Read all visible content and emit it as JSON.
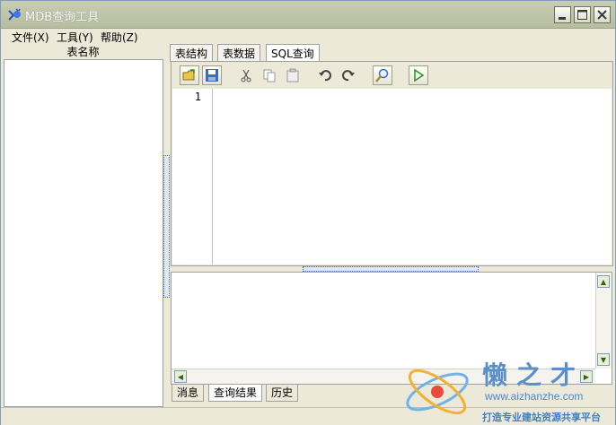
{
  "window": {
    "title": "MDB查询工具"
  },
  "menu": {
    "file": "文件(X)",
    "tools": "工具(Y)",
    "help": "帮助(Z)"
  },
  "left_pane": {
    "header": "表名称"
  },
  "top_tabs": [
    {
      "label": "表结构"
    },
    {
      "label": "表数据"
    },
    {
      "label": "SQL查询"
    }
  ],
  "editor": {
    "line_number": "1"
  },
  "bottom_tabs": [
    {
      "label": "消息"
    },
    {
      "label": "查询结果"
    },
    {
      "label": "历史"
    }
  ],
  "watermark": {
    "title": "懒之才",
    "url": "www.aizhanzhe.com",
    "slogan": "打造专业建站资源共享平台"
  }
}
